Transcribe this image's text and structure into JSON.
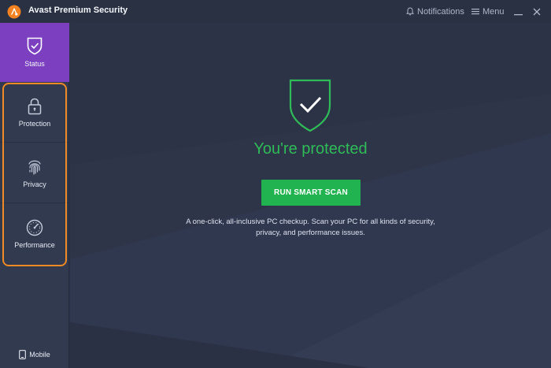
{
  "window": {
    "title": "Avast Premium Security",
    "notifications_label": "Notifications",
    "menu_label": "Menu"
  },
  "sidebar": {
    "items": [
      {
        "label": "Status",
        "icon": "shield-check-icon",
        "active": true
      },
      {
        "label": "Protection",
        "icon": "lock-icon"
      },
      {
        "label": "Privacy",
        "icon": "fingerprint-icon"
      },
      {
        "label": "Performance",
        "icon": "speedometer-icon"
      }
    ],
    "mobile_label": "Mobile"
  },
  "main": {
    "status_title": "You're protected",
    "scan_button_label": "RUN SMART SCAN",
    "description_line1": "A one-click, all-inclusive PC checkup. Scan your PC for all kinds of security,",
    "description_line2": "privacy, and performance issues."
  },
  "colors": {
    "accent_purple": "#7b3fc0",
    "success_green": "#2fbb57",
    "button_green": "#21b350",
    "highlight_orange": "#f08a24",
    "logo_orange": "#f58220"
  }
}
